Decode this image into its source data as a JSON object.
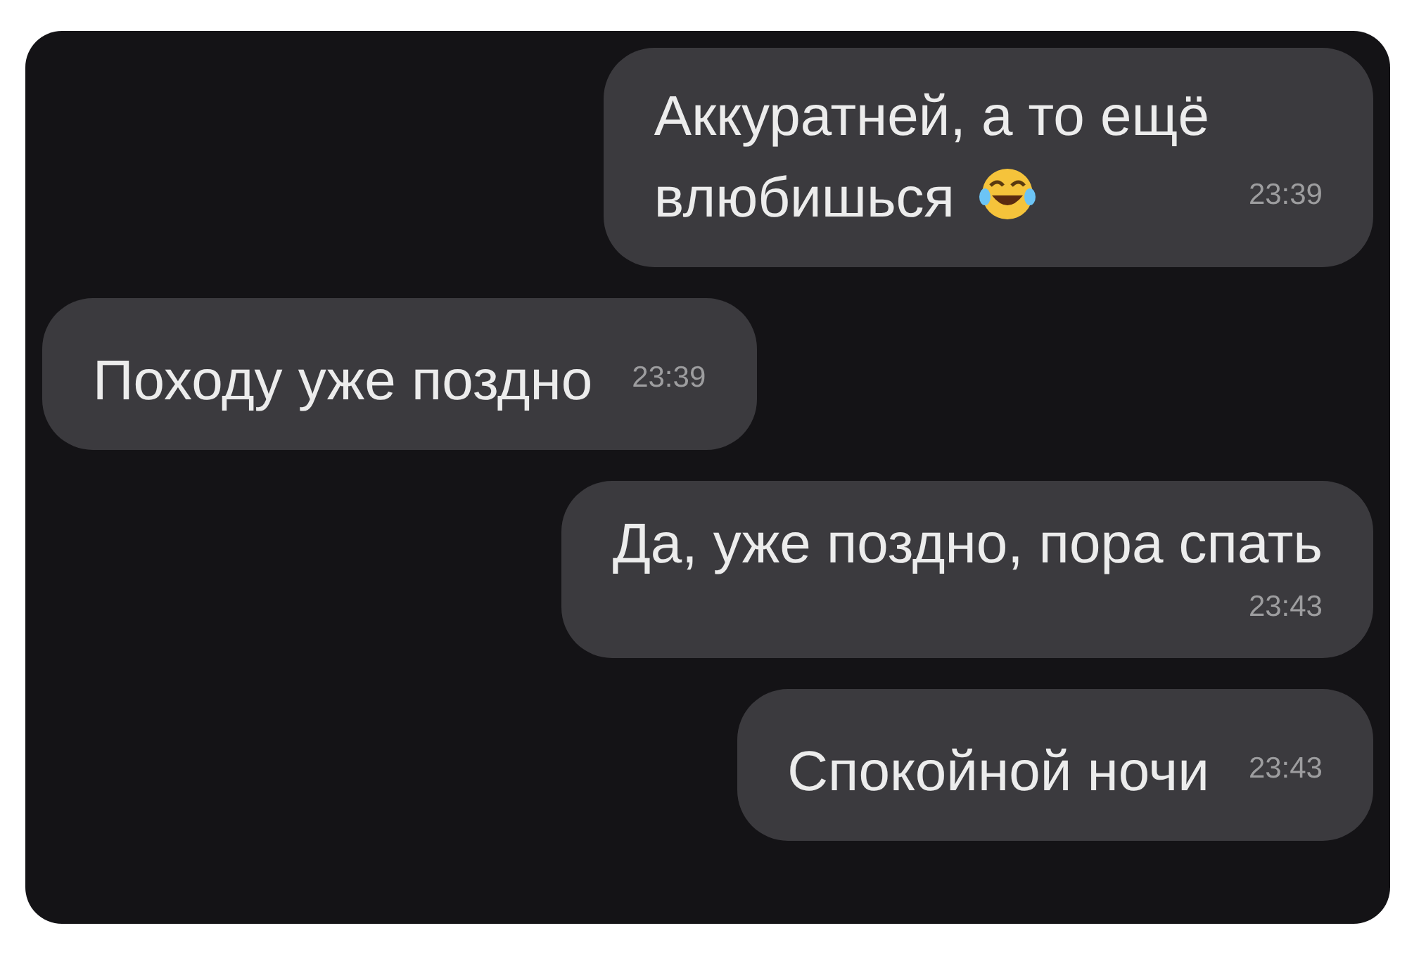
{
  "messages": [
    {
      "outgoing": true,
      "kind": "inline",
      "lines": [
        "Аккуратней, а то ещё",
        "влюбишься"
      ],
      "laughing_emoji": true,
      "time": "23:39"
    },
    {
      "outgoing": false,
      "kind": "inline",
      "lines": [
        "Походу уже поздно"
      ],
      "laughing_emoji": false,
      "time": "23:39"
    },
    {
      "outgoing": true,
      "kind": "stacked",
      "lines": [
        "Да, уже поздно, пора спать"
      ],
      "laughing_emoji": false,
      "time": "23:43"
    },
    {
      "outgoing": true,
      "kind": "inline",
      "lines": [
        "Спокойной ночи"
      ],
      "laughing_emoji": false,
      "time": "23:43"
    }
  ]
}
